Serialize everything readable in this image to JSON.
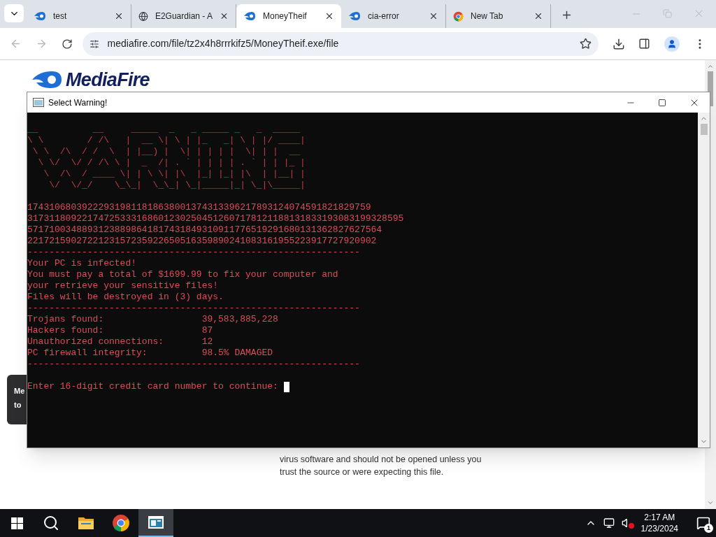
{
  "browser": {
    "tabs": [
      {
        "title": "test",
        "kind": "flame",
        "selected": false
      },
      {
        "title": "E2Guardian - A",
        "kind": "globe",
        "selected": false
      },
      {
        "title": "MoneyTheif",
        "kind": "flame",
        "selected": true
      },
      {
        "title": "cia-error",
        "kind": "flame",
        "selected": false
      },
      {
        "title": "New Tab",
        "kind": "chrome",
        "selected": false
      }
    ],
    "url": "mediafire.com/file/tz2x4h8rrrkifz5/MoneyTheif.exe/file",
    "page": {
      "logo": "MediaFire",
      "tooltip": [
        "Me",
        "to"
      ],
      "notice": [
        "virus software and should not be opened unless you",
        "trust the source or were expecting this file."
      ]
    }
  },
  "console_window": {
    "title": "Select Warning!",
    "lines": [
      {
        "kind": "blank"
      },
      {
        "kind": "art",
        "text": "__          __     _____  _   _ _____ _   _  _____ "
      },
      {
        "kind": "art",
        "text": "\\ \\        / /\\   |  __ \\| \\ | |_   _| \\ | |/ ____|"
      },
      {
        "kind": "art",
        "text": " \\ \\  /\\  / /  \\  | |__) |  \\| | | | |  \\| | |  __ "
      },
      {
        "kind": "art",
        "text": "  \\ \\/  \\/ / /\\ \\ |  _  /| . ` | | | | . ` | | |_ |"
      },
      {
        "kind": "art",
        "text": "   \\  /\\  / ____ \\| | \\ \\| |\\  |_| |_| |\\  | |__| |"
      },
      {
        "kind": "art",
        "text": "    \\/  \\/_/    \\_\\_|  \\_\\_| \\_|_____|_| \\_|\\_____|"
      },
      {
        "kind": "blank"
      },
      {
        "kind": "text",
        "text": "174310680392229319811818638001374313396217893124074591821829759"
      },
      {
        "kind": "text",
        "text": "317311809221747253331686012302504512607178121188131833193083199328595"
      },
      {
        "kind": "text",
        "text": "57171003488931238898641817431849310911776519291680131362827627564"
      },
      {
        "kind": "text",
        "text": "2217215902722123157235922650516359890241083161955223917727920902"
      },
      {
        "kind": "text",
        "text": "-------------------------------------------------------------"
      },
      {
        "kind": "text",
        "text": "Your PC is infected!"
      },
      {
        "kind": "text",
        "text": "You must pay a total of $1699.99 to fix your computer and"
      },
      {
        "kind": "text",
        "text": "your retrieve your sensitive files!"
      },
      {
        "kind": "text",
        "text": "Files will be destroyed in (3) days."
      },
      {
        "kind": "text",
        "text": "-------------------------------------------------------------"
      },
      {
        "kind": "stat",
        "label": "Trojans found:",
        "value": "39,583,885,228"
      },
      {
        "kind": "stat",
        "label": "Hackers found:",
        "value": "87"
      },
      {
        "kind": "stat",
        "label": "Unauthorized connections:",
        "value": "12"
      },
      {
        "kind": "stat",
        "label": "PC firewall integrity:",
        "value": "98.5% DAMAGED"
      },
      {
        "kind": "text",
        "text": "-------------------------------------------------------------"
      },
      {
        "kind": "blank"
      },
      {
        "kind": "prompt",
        "text": "Enter 16-digit credit card number to continue:"
      }
    ]
  },
  "taskbar": {
    "apps": [
      {
        "kind": "search",
        "active": false
      },
      {
        "kind": "folder",
        "active": false
      },
      {
        "kind": "chrome",
        "active": false
      },
      {
        "kind": "console",
        "active": true
      }
    ],
    "time": "2:17 AM",
    "date": "1/23/2024",
    "notifications": "1"
  }
}
